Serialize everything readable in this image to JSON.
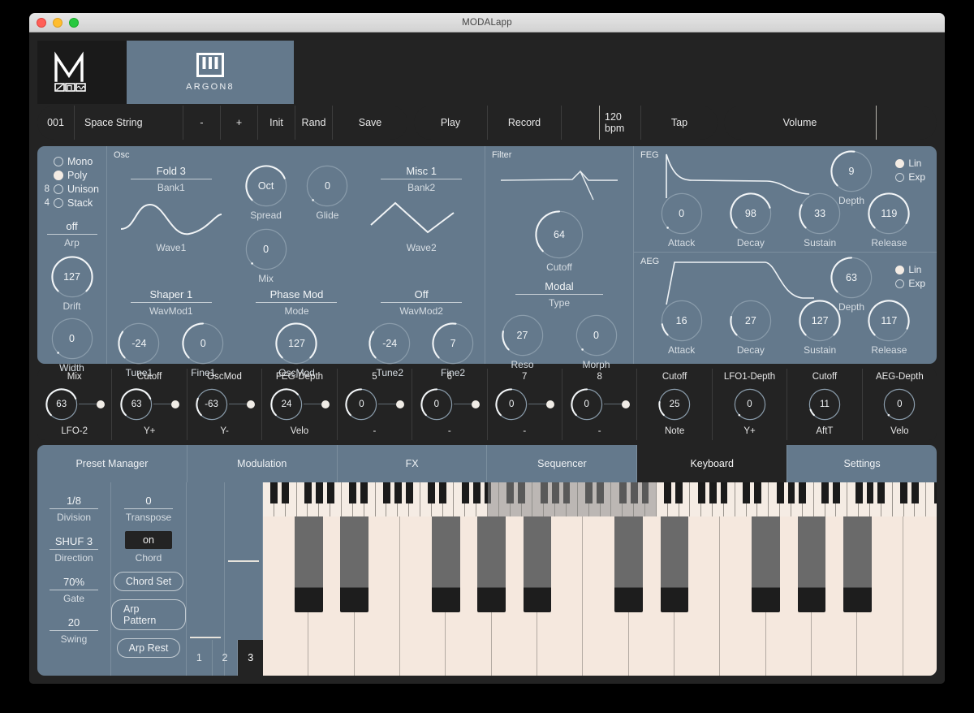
{
  "window": {
    "title": "MODALapp"
  },
  "brand": {
    "logo_icon": "modal-m-logo",
    "product_icon": "piano-keys-icon",
    "product": "ARGON8"
  },
  "toolbar": {
    "preset_number": "001",
    "preset_name": "Space String",
    "prev_label": "-",
    "next_label": "+",
    "init_label": "Init",
    "rand_label": "Rand",
    "save_label": "Save",
    "play_label": "Play",
    "record_label": "Record",
    "blank_label": "",
    "bpm_label": "120 bpm",
    "tap_label": "Tap",
    "volume_label": "Volume"
  },
  "voice": {
    "modes": [
      {
        "label": "Mono",
        "num": "",
        "selected": false
      },
      {
        "label": "Poly",
        "num": "",
        "selected": true
      },
      {
        "label": "Unison",
        "num": "8",
        "selected": false
      },
      {
        "label": "Stack",
        "num": "4",
        "selected": false
      }
    ],
    "arp": {
      "value": "off",
      "caption": "Arp"
    },
    "drift": {
      "value": "127",
      "caption": "Drift",
      "pct": 100
    },
    "width": {
      "value": "0",
      "caption": "Width",
      "pct": 0
    }
  },
  "osc": {
    "section_label": "Osc",
    "bank1": {
      "value": "Fold 3",
      "caption": "Bank1"
    },
    "wave1_caption": "Wave1",
    "wave1_shape": "sine",
    "spread": {
      "value": "Oct",
      "caption": "Spread",
      "pct": 75
    },
    "glide": {
      "value": "0",
      "caption": "Glide",
      "pct": 0
    },
    "mix": {
      "value": "0",
      "caption": "Mix",
      "pct": 0
    },
    "bank2": {
      "value": "Misc 1",
      "caption": "Bank2"
    },
    "wave2_caption": "Wave2",
    "wave2_shape": "triangle",
    "wavmod1": {
      "value": "Shaper 1",
      "caption": "WavMod1"
    },
    "mode": {
      "value": "Phase Mod",
      "caption": "Mode"
    },
    "wavmod2": {
      "value": "Off",
      "caption": "WavMod2"
    },
    "tune1": {
      "value": "-24",
      "caption": "Tune1",
      "pct": 30
    },
    "fine1": {
      "value": "0",
      "caption": "Fine1",
      "pct": 50
    },
    "oscmod": {
      "value": "127",
      "caption": "OscMod",
      "pct": 100
    },
    "tune2": {
      "value": "-24",
      "caption": "Tune2",
      "pct": 30
    },
    "fine2": {
      "value": "7",
      "caption": "Fine2",
      "pct": 53
    }
  },
  "filter": {
    "section_label": "Filter",
    "cutoff": {
      "value": "64",
      "caption": "Cutoff",
      "pct": 50
    },
    "type": {
      "value": "Modal",
      "caption": "Type"
    },
    "reso": {
      "value": "27",
      "caption": "Reso",
      "pct": 21
    },
    "morph": {
      "value": "0",
      "caption": "Morph",
      "pct": 0
    }
  },
  "feg": {
    "section_label": "FEG",
    "attack": {
      "value": "0",
      "caption": "Attack",
      "pct": 0
    },
    "decay": {
      "value": "98",
      "caption": "Decay",
      "pct": 77
    },
    "sustain": {
      "value": "33",
      "caption": "Sustain",
      "pct": 26
    },
    "release": {
      "value": "119",
      "caption": "Release",
      "pct": 94
    },
    "depth": {
      "value": "9",
      "caption": "Depth",
      "pct": 53
    },
    "lin_label": "Lin",
    "exp_label": "Exp",
    "curve": "Lin"
  },
  "aeg": {
    "section_label": "AEG",
    "attack": {
      "value": "16",
      "caption": "Attack",
      "pct": 13
    },
    "decay": {
      "value": "27",
      "caption": "Decay",
      "pct": 21
    },
    "sustain": {
      "value": "127",
      "caption": "Sustain",
      "pct": 100
    },
    "release": {
      "value": "117",
      "caption": "Release",
      "pct": 92
    },
    "depth": {
      "value": "63",
      "caption": "Depth",
      "pct": 50
    },
    "lin_label": "Lin",
    "exp_label": "Exp",
    "curve": "Lin"
  },
  "mod_matrix": [
    {
      "dest": "Mix",
      "value": "63",
      "src": "LFO-2",
      "pct": 75,
      "pin": true
    },
    {
      "dest": "Cutoff",
      "value": "63",
      "src": "Y+",
      "pct": 75,
      "pin": true
    },
    {
      "dest": "OscMod",
      "value": "-63",
      "src": "Y-",
      "pct": 25,
      "pin": true
    },
    {
      "dest": "FEG-Depth",
      "value": "24",
      "src": "Velo",
      "pct": 68,
      "pin": true
    },
    {
      "dest": "5",
      "value": "0",
      "src": "-",
      "pct": 50,
      "pin": true
    },
    {
      "dest": "6",
      "value": "0",
      "src": "-",
      "pct": 50,
      "pin": true
    },
    {
      "dest": "7",
      "value": "0",
      "src": "-",
      "pct": 50,
      "pin": true
    },
    {
      "dest": "8",
      "value": "0",
      "src": "-",
      "pct": 50,
      "pin": true
    },
    {
      "dest": "Cutoff",
      "value": "25",
      "src": "Note",
      "pct": 20,
      "pin": false
    },
    {
      "dest": "LFO1-Depth",
      "value": "0",
      "src": "Y+",
      "pct": 0,
      "pin": false
    },
    {
      "dest": "Cutoff",
      "value": "11",
      "src": "AftT",
      "pct": 9,
      "pin": false
    },
    {
      "dest": "AEG-Depth",
      "value": "0",
      "src": "Velo",
      "pct": 0,
      "pin": false
    }
  ],
  "tabs": [
    {
      "label": "Preset Manager",
      "active": false
    },
    {
      "label": "Modulation",
      "active": false
    },
    {
      "label": "FX",
      "active": false
    },
    {
      "label": "Sequencer",
      "active": false
    },
    {
      "label": "Keyboard",
      "active": true
    },
    {
      "label": "Settings",
      "active": false
    }
  ],
  "arp": {
    "division": {
      "value": "1/8",
      "caption": "Division"
    },
    "direction": {
      "value": "SHUF 3",
      "caption": "Direction"
    },
    "gate": {
      "value": "70%",
      "caption": "Gate"
    },
    "swing": {
      "value": "20",
      "caption": "Swing"
    },
    "transpose": {
      "value": "0",
      "caption": "Transpose"
    },
    "chord": {
      "value": "on",
      "caption": "Chord"
    },
    "chord_set_label": "Chord Set",
    "arp_pattern_label": "Arp Pattern",
    "arp_rest_label": "Arp Rest"
  },
  "wheels": {
    "page_tabs": [
      {
        "label": "1",
        "active": false
      },
      {
        "label": "2",
        "active": false
      },
      {
        "label": "3",
        "active": true
      }
    ]
  },
  "colors": {
    "panel": "#64798c",
    "dark": "#232323",
    "accent": "#f4ece4",
    "key_white": "#f5e8de",
    "key_black": "#1d1d1d",
    "divider": "#7b8e9e"
  }
}
